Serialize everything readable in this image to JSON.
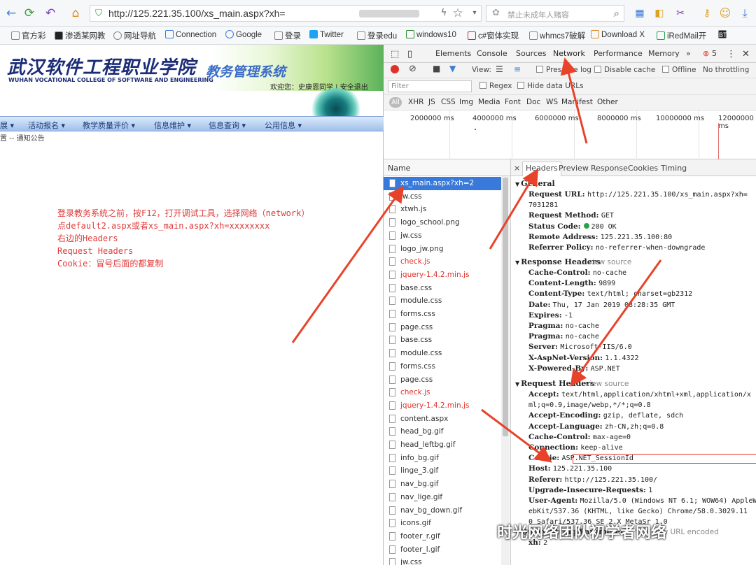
{
  "browser": {
    "url": "http://125.221.35.100/xs_main.aspx?xh=",
    "search_placeholder": "禁止未成年人赌容",
    "bookmarks": [
      "官方彩",
      "渗透某网教",
      "网址导航",
      "Connection",
      "Google",
      "登录",
      "Twitter",
      "登录edu",
      "windows10",
      "c#窗体实现",
      "whmcs7破解",
      "Download X",
      "iRedMail开",
      "BT"
    ]
  },
  "page": {
    "school_name": "武汉软件工程职业学院",
    "school_en": "WUHAN VOCATIONAL COLLEGE OF SOFTWARE AND ENGINEERING",
    "system_name": "教务管理系统",
    "welcome": "欢迎您：史康恩同学 | 安全退出",
    "nav": [
      "展 ▾",
      "活动报名 ▾",
      "教学质量评价 ▾",
      "信息维护 ▾",
      "信息查询 ▾",
      "公用信息 ▾"
    ],
    "breadcrumb": "置 -- 通知公告",
    "note_lines": [
      "登录教务系统之前，按F12，打开调试工具，选择网络（network）",
      "点default2.aspx或者xs_main.aspx?xh=xxxxxxxx",
      "右边的Headers",
      "Request Headers",
      "Cookie：冒号后面的都复制"
    ]
  },
  "devtools": {
    "tabs": [
      "Elements",
      "Console",
      "Sources",
      "Network",
      "Performance",
      "Memory",
      "»"
    ],
    "error_count": "5",
    "controls": {
      "view": "View:",
      "preserve": "Preserve log",
      "disable_cache": "Disable cache",
      "offline": "Offline",
      "throttle": "No throttling"
    },
    "filter_placeholder": "Filter",
    "regex": "Regex",
    "hide_data": "Hide data URLs",
    "types": [
      "All",
      "XHR",
      "JS",
      "CSS",
      "Img",
      "Media",
      "Font",
      "Doc",
      "WS",
      "Manifest",
      "Other"
    ],
    "timeline_ticks": [
      "2000000 ms",
      "4000000 ms",
      "6000000 ms",
      "8000000 ms",
      "10000000 ms",
      "12000000 ms"
    ],
    "list_header": "Name",
    "requests": [
      {
        "name": "xs_main.aspx?xh=2",
        "state": "selected"
      },
      {
        "name": "jw.css",
        "state": "normal"
      },
      {
        "name": "xtwh.js",
        "state": "normal"
      },
      {
        "name": "logo_school.png",
        "state": "normal"
      },
      {
        "name": "jw.css",
        "state": "normal"
      },
      {
        "name": "logo_jw.png",
        "state": "normal"
      },
      {
        "name": "check.js",
        "state": "error"
      },
      {
        "name": "jquery-1.4.2.min.js",
        "state": "error"
      },
      {
        "name": "base.css",
        "state": "normal"
      },
      {
        "name": "module.css",
        "state": "normal"
      },
      {
        "name": "forms.css",
        "state": "normal"
      },
      {
        "name": "page.css",
        "state": "normal"
      },
      {
        "name": "base.css",
        "state": "normal"
      },
      {
        "name": "module.css",
        "state": "normal"
      },
      {
        "name": "forms.css",
        "state": "normal"
      },
      {
        "name": "page.css",
        "state": "normal"
      },
      {
        "name": "check.js",
        "state": "error"
      },
      {
        "name": "jquery-1.4.2.min.js",
        "state": "error"
      },
      {
        "name": "content.aspx",
        "state": "normal"
      },
      {
        "name": "head_bg.gif",
        "state": "normal"
      },
      {
        "name": "head_leftbg.gif",
        "state": "normal"
      },
      {
        "name": "info_bg.gif",
        "state": "normal"
      },
      {
        "name": "linge_3.gif",
        "state": "normal"
      },
      {
        "name": "nav_bg.gif",
        "state": "normal"
      },
      {
        "name": "nav_lige.gif",
        "state": "normal"
      },
      {
        "name": "nav_bg_down.gif",
        "state": "normal"
      },
      {
        "name": "icons.gif",
        "state": "normal"
      },
      {
        "name": "footer_r.gif",
        "state": "normal"
      },
      {
        "name": "footer_l.gif",
        "state": "normal"
      },
      {
        "name": "jw.css",
        "state": "normal"
      }
    ],
    "panel_tabs": [
      "×",
      "Headers",
      "Preview",
      "Response",
      "Cookies",
      "Timing"
    ],
    "general_title": "General",
    "general": [
      {
        "k": "Request URL:",
        "v": "http://125.221.35.100/xs_main.aspx?xh="
      },
      {
        "k": "",
        "v": "7031281"
      },
      {
        "k": "Request Method:",
        "v": "GET"
      },
      {
        "k": "Status Code:",
        "v": "200 OK"
      },
      {
        "k": "Remote Address:",
        "v": "125.221.35.100:80"
      },
      {
        "k": "Referrer Policy:",
        "v": "no-referrer-when-downgrade"
      }
    ],
    "response_title": "Response Headers",
    "view_source": "view source",
    "response": [
      {
        "k": "Cache-Control:",
        "v": "no-cache"
      },
      {
        "k": "Content-Length:",
        "v": "9899"
      },
      {
        "k": "Content-Type:",
        "v": "text/html; charset=gb2312"
      },
      {
        "k": "Date:",
        "v": "Thu, 17 Jan 2019 08:28:35 GMT"
      },
      {
        "k": "Expires:",
        "v": "-1"
      },
      {
        "k": "Pragma:",
        "v": "no-cache"
      },
      {
        "k": "Pragma:",
        "v": "no-cache"
      },
      {
        "k": "Server:",
        "v": "Microsoft-IIS/6.0"
      },
      {
        "k": "X-AspNet-Version:",
        "v": "1.1.4322"
      },
      {
        "k": "X-Powered-By:",
        "v": "ASP.NET"
      }
    ],
    "request_title": "Request Headers",
    "request": [
      {
        "k": "Accept:",
        "v": "text/html,application/xhtml+xml,application/x"
      },
      {
        "k": "",
        "v": "ml;q=0.9,image/webp,*/*;q=0.8"
      },
      {
        "k": "Accept-Encoding:",
        "v": "gzip, deflate, sdch"
      },
      {
        "k": "Accept-Language:",
        "v": "zh-CN,zh;q=0.8"
      },
      {
        "k": "Cache-Control:",
        "v": "max-age=0"
      },
      {
        "k": "Connection:",
        "v": "keep-alive"
      },
      {
        "k": "Cookie:",
        "v": "ASP.NET_SessionId"
      },
      {
        "k": "Host:",
        "v": "125.221.35.100"
      },
      {
        "k": "Referer:",
        "v": "http://125.221.35.100/"
      },
      {
        "k": "Upgrade-Insecure-Requests:",
        "v": "1"
      },
      {
        "k": "User-Agent:",
        "v": "Mozilla/5.0 (Windows NT 6.1; WOW64) AppleW"
      },
      {
        "k": "",
        "v": "ebKit/537.36 (KHTML, like Gecko) Chrome/58.0.3029.11"
      },
      {
        "k": "",
        "v": "0 Safari/537.36 SE 2.X MetaSr 1.0"
      }
    ],
    "query_title": "Query String Parameters",
    "view_url_encoded": "view URL encoded",
    "query": [
      {
        "k": "xh:",
        "v": "2"
      }
    ]
  },
  "watermark": "时光网络团队初学者网络"
}
